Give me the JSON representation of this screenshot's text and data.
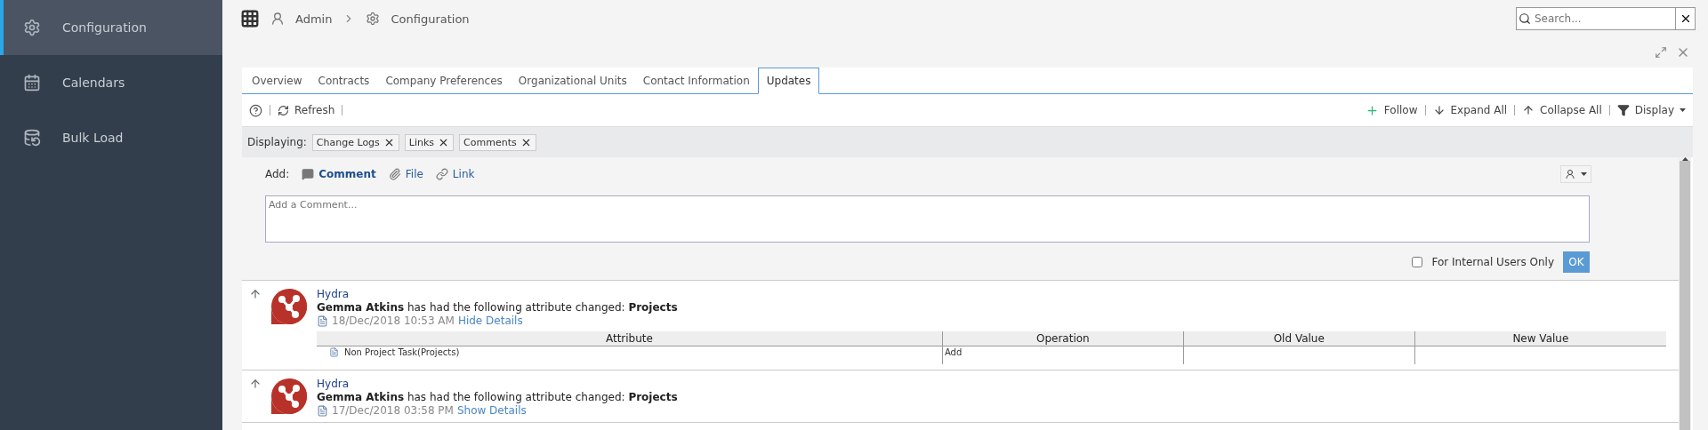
{
  "sidebar": {
    "items": [
      {
        "label": "Configuration",
        "selected": true
      },
      {
        "label": "Calendars",
        "selected": false
      },
      {
        "label": "Bulk Load",
        "selected": false
      }
    ]
  },
  "breadcrumb": [
    "Admin",
    "Configuration"
  ],
  "search": {
    "placeholder": "Search..."
  },
  "tabs": [
    {
      "label": "Overview",
      "selected": false
    },
    {
      "label": "Contracts",
      "selected": false
    },
    {
      "label": "Company Preferences",
      "selected": false
    },
    {
      "label": "Organizational Units",
      "selected": false
    },
    {
      "label": "Contact Information",
      "selected": false
    },
    {
      "label": "Updates",
      "selected": true
    }
  ],
  "toolbar": {
    "refresh": "Refresh",
    "follow": "Follow",
    "expand_all": "Expand All",
    "collapse_all": "Collapse All",
    "display": "Display"
  },
  "filter": {
    "label": "Displaying:",
    "chips": [
      "Change Logs",
      "Links",
      "Comments"
    ]
  },
  "composer": {
    "label": "Add:",
    "options": [
      {
        "kind": "comment",
        "label": "Comment",
        "selected": true
      },
      {
        "kind": "file",
        "label": "File",
        "selected": false
      },
      {
        "kind": "link",
        "label": "Link",
        "selected": false
      }
    ],
    "placeholder": "Add a Comment...",
    "internal": {
      "label": "For Internal Users Only",
      "checked": false
    },
    "submit": "OK"
  },
  "feed": [
    {
      "source": "Hydra",
      "message": "**Gemma Atkins** has had the following attribute changed: **Projects**",
      "date": "18/Dec/2018 10:53 AM",
      "toggle": "Hide Details",
      "details": {
        "columns": [
          "Attribute",
          "Operation",
          "Old Value",
          "New Value"
        ],
        "rows": [
          [
            "Non Project Task(Projects)",
            "Add",
            "",
            ""
          ]
        ]
      }
    },
    {
      "source": "Hydra",
      "message": "**Gemma Atkins** has had the following attribute changed: **Projects**",
      "date": "17/Dec/2018 03:58 PM",
      "toggle": "Show Details"
    }
  ]
}
